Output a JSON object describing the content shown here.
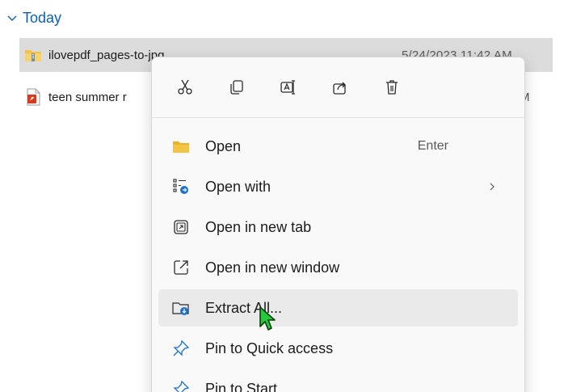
{
  "group": {
    "label": "Today"
  },
  "files": [
    {
      "name": "ilovepdf_pages-to-jpg",
      "date": "5/24/2023 11:42 AM",
      "selected": true
    },
    {
      "name": "teen summer r",
      "date": "M",
      "selected": false
    }
  ],
  "quick_actions": [
    {
      "name": "cut",
      "icon": "scissors-icon"
    },
    {
      "name": "copy",
      "icon": "copy-icon"
    },
    {
      "name": "rename",
      "icon": "rename-icon"
    },
    {
      "name": "share",
      "icon": "share-icon"
    },
    {
      "name": "delete",
      "icon": "trash-icon"
    }
  ],
  "menu": {
    "items": [
      {
        "label": "Open",
        "shortcut": "Enter",
        "icon": "folder-icon"
      },
      {
        "label": "Open with",
        "icon": "open-with-icon",
        "submenu": true
      },
      {
        "label": "Open in new tab",
        "icon": "new-tab-icon"
      },
      {
        "label": "Open in new window",
        "icon": "new-window-icon"
      },
      {
        "label": "Extract All...",
        "icon": "extract-icon",
        "hovered": true
      },
      {
        "label": "Pin to Quick access",
        "icon": "pin-icon"
      },
      {
        "label": "Pin to Start",
        "icon": "pin-start-icon"
      }
    ]
  },
  "colors": {
    "accent": "#0f5fae",
    "selected_row": "#dcdcdc",
    "menu_bg": "#f9f9f9",
    "hover": "#eaeaea",
    "folder_yellow": "#f3c346",
    "pdf_red": "#d93a1e"
  }
}
